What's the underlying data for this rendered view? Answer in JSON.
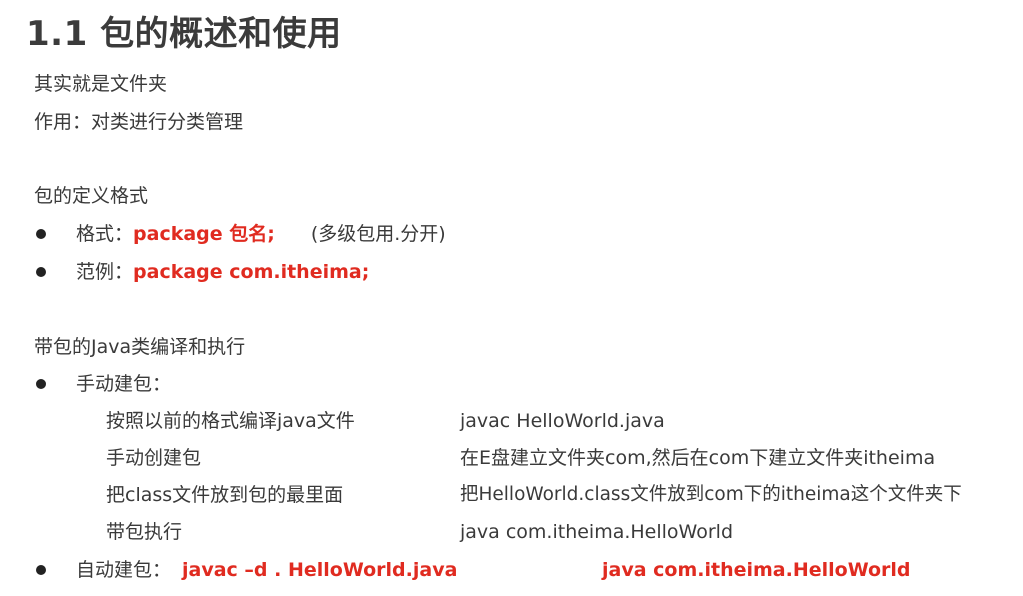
{
  "title": "1.1 包的概述和使用",
  "intro": {
    "line1": "其实就是文件夹",
    "line2": "作用：对类进行分类管理"
  },
  "definition": {
    "heading": "包的定义格式",
    "items": [
      {
        "label": "格式：",
        "code": "package 包名;",
        "note": "(多级包用.分开)"
      },
      {
        "label": "范例：",
        "code": "package com.itheima;"
      }
    ]
  },
  "compile": {
    "heading": "带包的Java类编译和执行",
    "manual": {
      "label": "手动建包：",
      "steps": [
        {
          "desc": "按照以前的格式编译java文件",
          "detail": "javac HelloWorld.java"
        },
        {
          "desc": "手动创建包",
          "detail": "在E盘建立文件夹com,然后在com下建立文件夹itheima"
        },
        {
          "desc": "把class文件放到包的最里面",
          "detail": "把HelloWorld.class文件放到com下的itheima这个文件夹下"
        },
        {
          "desc": "带包执行",
          "detail": "java com.itheima.HelloWorld"
        }
      ]
    },
    "auto": {
      "label": "自动建包：",
      "command1": "javac –d . HelloWorld.java",
      "command2": "java com.itheima.HelloWorld"
    }
  },
  "colors": {
    "accent": "#e02b20",
    "text": "#3a3a3a"
  }
}
